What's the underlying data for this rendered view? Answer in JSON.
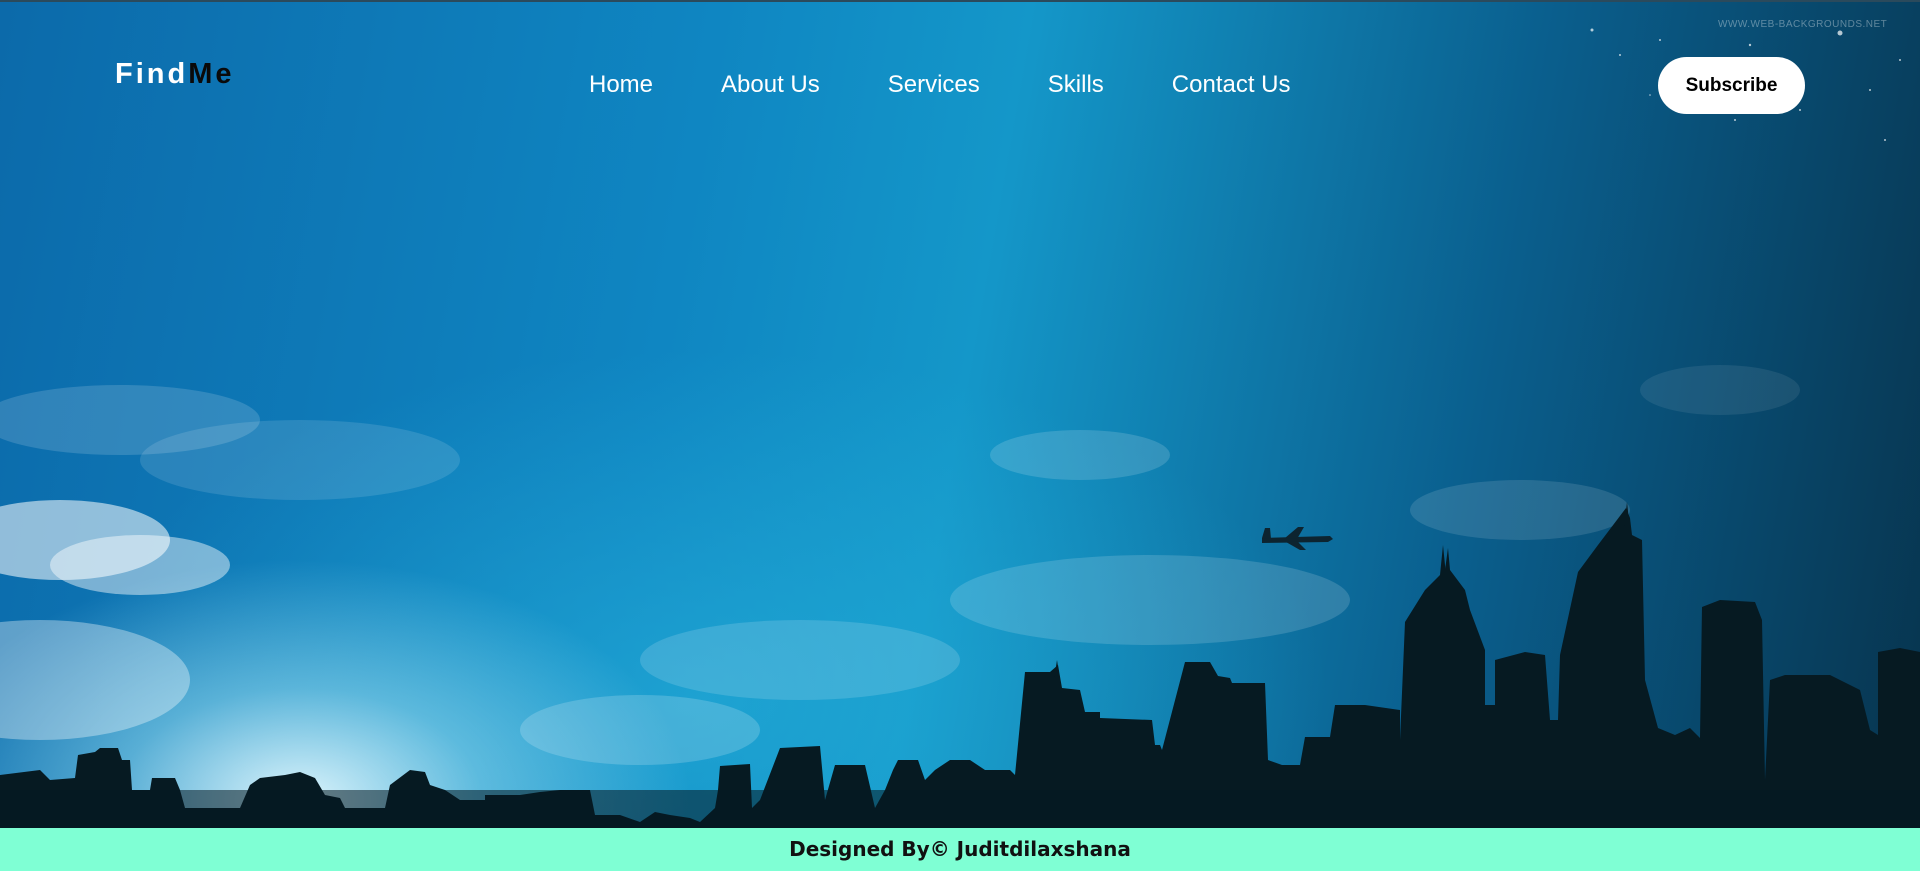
{
  "brand": {
    "logo_part1": "Find",
    "logo_part2": "Me"
  },
  "nav": {
    "items": [
      {
        "label": "Home"
      },
      {
        "label": "About Us"
      },
      {
        "label": "Services"
      },
      {
        "label": "Skills"
      },
      {
        "label": "Contact Us"
      }
    ]
  },
  "header": {
    "subscribe_label": "Subscribe"
  },
  "background": {
    "watermark": "WWW.WEB-BACKGROUNDS.NET"
  },
  "footer": {
    "credit": "Designed By© Juditdilaxshana"
  },
  "colors": {
    "footer_bg": "#7fffd4",
    "sky_top": "#0c6aaa",
    "sky_dark": "#07344e",
    "skyline": "#061a22",
    "button_bg": "#ffffff"
  }
}
